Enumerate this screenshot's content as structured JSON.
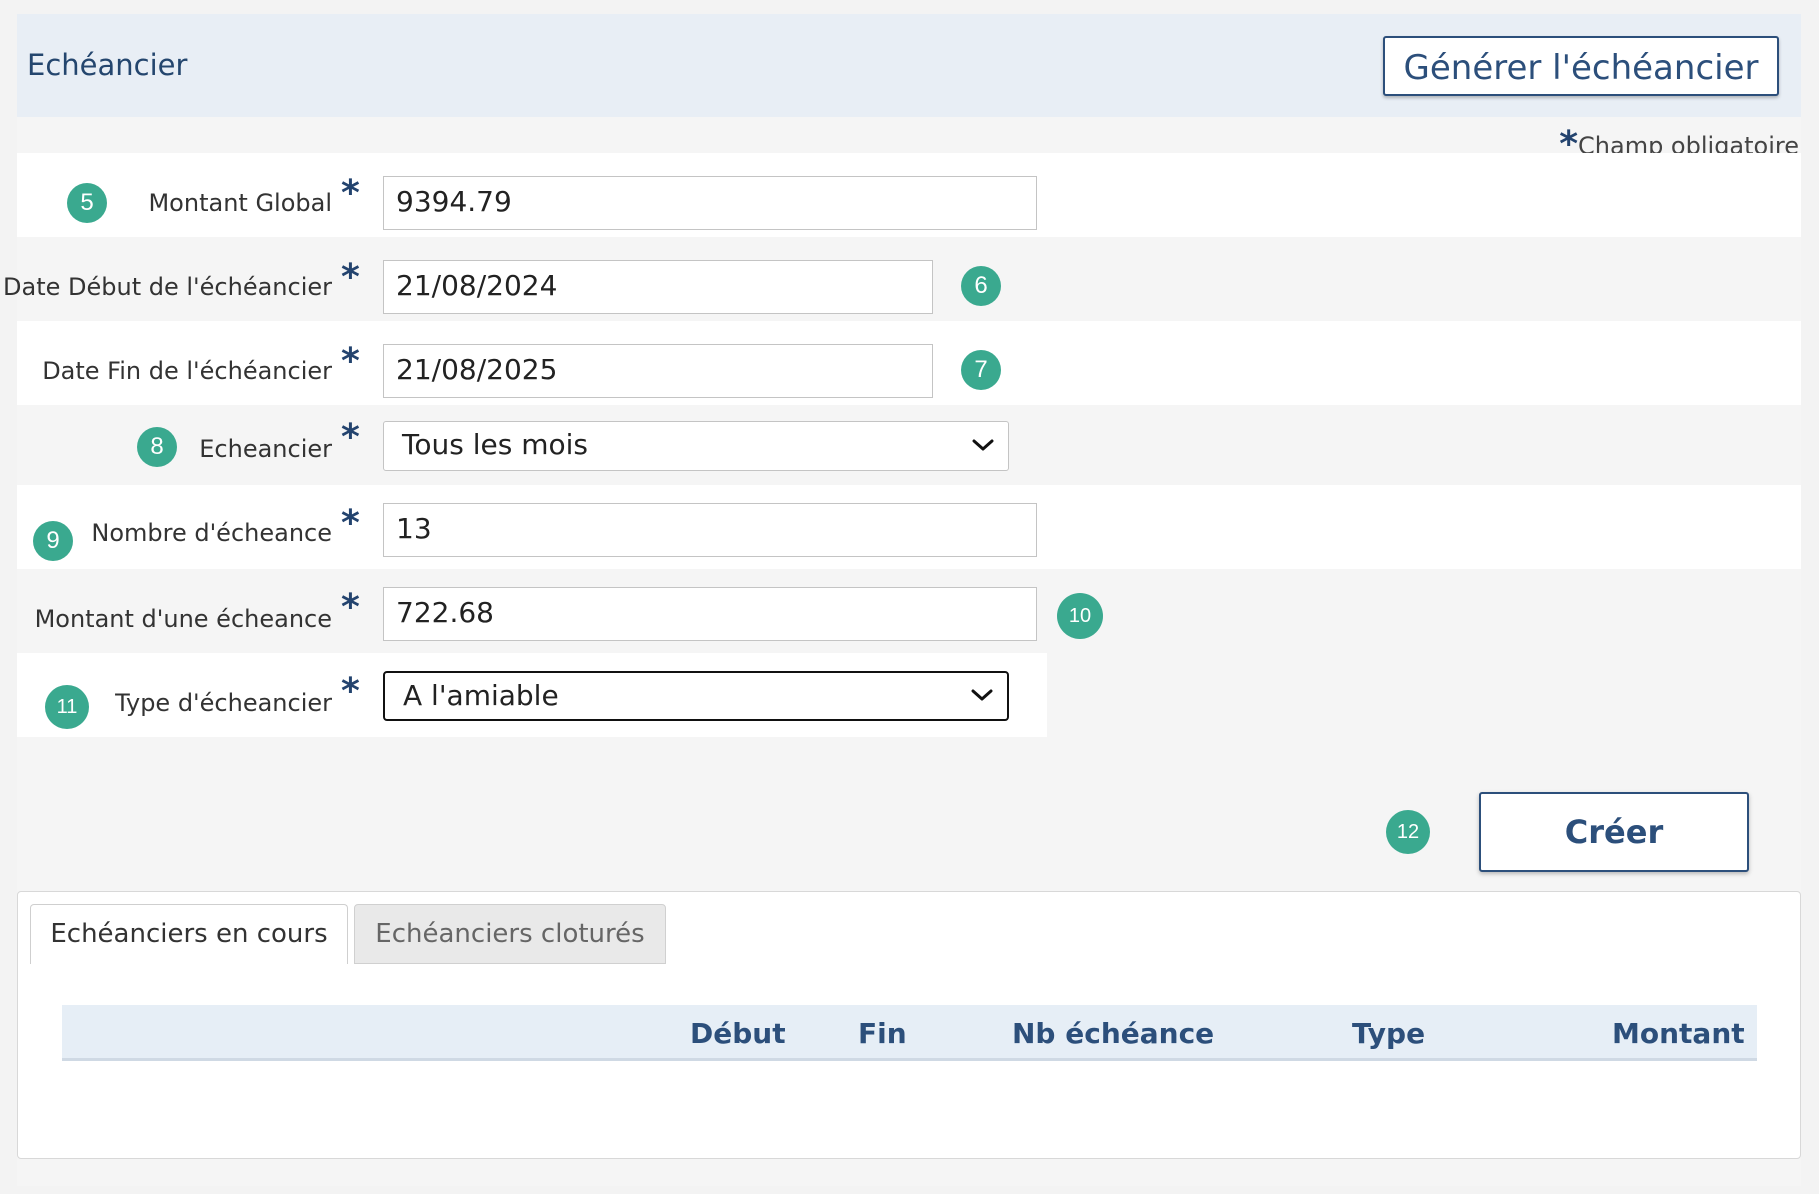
{
  "header": {
    "title": "Echéancier",
    "generate_button": "Générer l'échéancier"
  },
  "required_note": {
    "star": "*",
    "text": "Champ obligatoire"
  },
  "form": {
    "star": "*",
    "montant_global": {
      "label": "Montant Global",
      "value": "9394.79",
      "badge": "5"
    },
    "date_debut": {
      "label": "Date Début de l'échéancier",
      "value": "21/08/2024",
      "badge": "6"
    },
    "date_fin": {
      "label": "Date Fin de l'échéancier",
      "value": "21/08/2025",
      "badge": "7"
    },
    "echeancier": {
      "label": "Echeancier",
      "value": "Tous les mois",
      "badge": "8"
    },
    "nombre": {
      "label": "Nombre d'écheance",
      "value": "13",
      "badge": "9"
    },
    "montant_echeance": {
      "label": "Montant d'une écheance",
      "value": "722.68",
      "badge": "10"
    },
    "type": {
      "label": "Type d'écheancier",
      "value": "A l'amiable",
      "badge": "11"
    }
  },
  "create": {
    "label": "Créer",
    "badge": "12"
  },
  "tabs": [
    {
      "label": "Echéanciers en cours",
      "active": true
    },
    {
      "label": "Echéanciers cloturés",
      "active": false
    }
  ],
  "table": {
    "columns": [
      "Début",
      "Fin",
      "Nb échéance",
      "Type",
      "Montant"
    ]
  },
  "colors": {
    "accent": "#2c4f7b",
    "badge": "#3aa98f",
    "header_bg": "#e8eef5"
  }
}
